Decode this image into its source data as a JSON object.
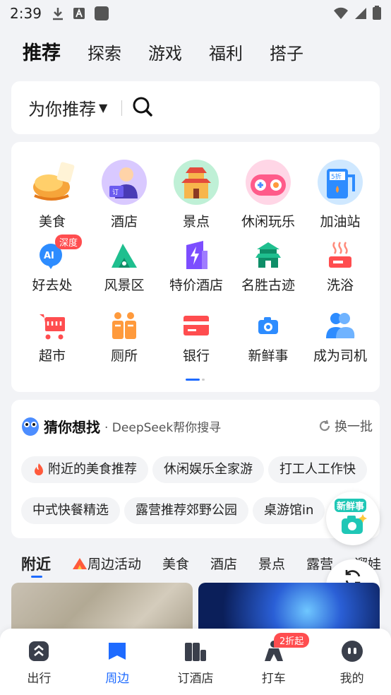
{
  "status_bar": {
    "time": "2:39"
  },
  "top_tabs": [
    {
      "label": "推荐",
      "active": true
    },
    {
      "label": "探索",
      "active": false
    },
    {
      "label": "游戏",
      "active": false
    },
    {
      "label": "福利",
      "active": false
    },
    {
      "label": "搭子",
      "active": false
    }
  ],
  "search": {
    "label": "为你推荐"
  },
  "grid": [
    {
      "label": "美食",
      "icon": "roast-chicken-icon"
    },
    {
      "label": "酒店",
      "icon": "hotel-receptionist-icon"
    },
    {
      "label": "景点",
      "icon": "pagoda-icon"
    },
    {
      "label": "休闲玩乐",
      "icon": "gamepad-icon"
    },
    {
      "label": "加油站",
      "icon": "fuel-pump-icon"
    },
    {
      "label": "好去处",
      "icon": "ai-pin-icon",
      "badge": "深度"
    },
    {
      "label": "风景区",
      "icon": "mountain-icon"
    },
    {
      "label": "特价酒店",
      "icon": "lightning-building-icon"
    },
    {
      "label": "名胜古迹",
      "icon": "temple-icon"
    },
    {
      "label": "洗浴",
      "icon": "bath-icon"
    },
    {
      "label": "超市",
      "icon": "shopping-cart-icon"
    },
    {
      "label": "厕所",
      "icon": "restroom-icon"
    },
    {
      "label": "银行",
      "icon": "bank-card-icon"
    },
    {
      "label": "新鲜事",
      "icon": "camera-icon"
    },
    {
      "label": "成为司机",
      "icon": "driver-icon"
    }
  ],
  "guess": {
    "title": "猜你想找",
    "subtitle": "· DeepSeek帮你搜寻",
    "refresh_label": "换一批",
    "row1": [
      "附近的美食推荐",
      "休闲娱乐全家游",
      "打工人工作快"
    ],
    "row2": [
      "中式快餐精选",
      "露营推荐郊野公园",
      "桌游馆in"
    ]
  },
  "news_fab": {
    "label": "新鲜事"
  },
  "category_tabs": [
    {
      "label": "附近",
      "active": true
    },
    {
      "label": "周边活动",
      "active": false
    },
    {
      "label": "美食",
      "active": false
    },
    {
      "label": "酒店",
      "active": false
    },
    {
      "label": "景点",
      "active": false
    },
    {
      "label": "露营",
      "active": false
    },
    {
      "label": "遛娃",
      "active": false
    }
  ],
  "refresh_fab": {
    "label": "刷新"
  },
  "bottom_nav": [
    {
      "label": "出行",
      "icon": "travel-icon",
      "active": false
    },
    {
      "label": "周边",
      "icon": "nearby-icon",
      "active": true
    },
    {
      "label": "订酒店",
      "icon": "hotel-icon",
      "active": false
    },
    {
      "label": "打车",
      "icon": "taxi-icon",
      "active": false,
      "badge": "2折起"
    },
    {
      "label": "我的",
      "icon": "profile-icon",
      "active": false
    }
  ],
  "colors": {
    "accent": "#1e6bff",
    "badge": "#ff4d4f",
    "background": "#f2f3f6"
  }
}
